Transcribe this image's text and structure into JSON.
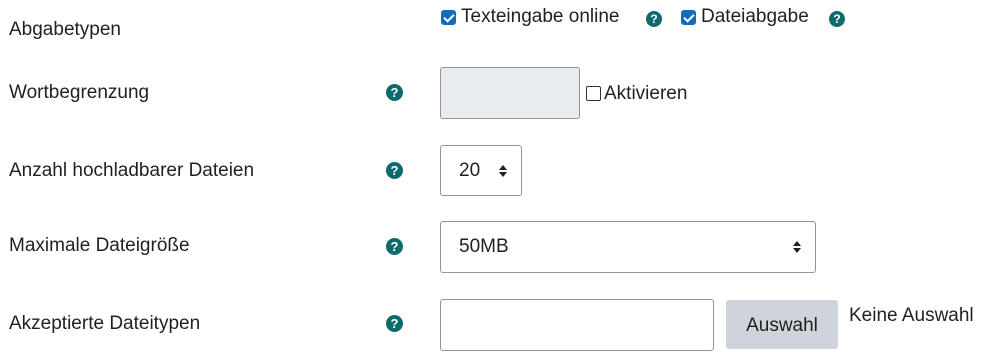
{
  "rows": {
    "submission_types": {
      "label": "Abgabetypen",
      "options": [
        {
          "label": "Texteingabe online",
          "checked": true
        },
        {
          "label": "Dateiabgabe",
          "checked": true
        }
      ]
    },
    "word_limit": {
      "label": "Wortbegrenzung",
      "value": "",
      "enable_label": "Aktivieren",
      "enabled": false
    },
    "max_files": {
      "label": "Anzahl hochladbarer Dateien",
      "selected": "20"
    },
    "max_size": {
      "label": "Maximale Dateigröße",
      "selected": "50MB"
    },
    "accepted_types": {
      "label": "Akzeptierte Dateitypen",
      "value": "",
      "button_label": "Auswahl",
      "status": "Keine Auswahl"
    }
  },
  "help_icon_glyph": "?",
  "colors": {
    "help_icon": "#0f6b6b",
    "checkbox_checked": "#0f6cbf",
    "disabled_input": "#e9ecef",
    "button": "#ced4da"
  }
}
